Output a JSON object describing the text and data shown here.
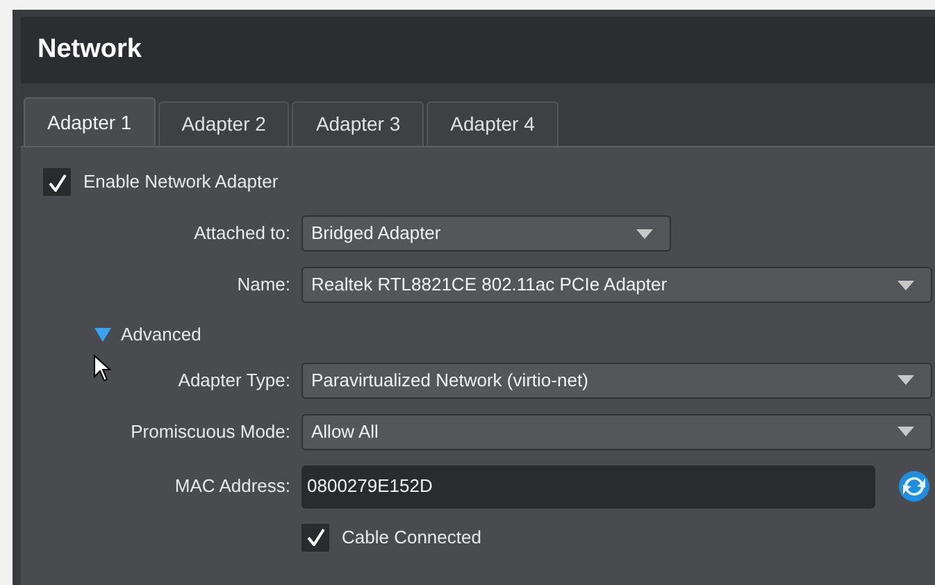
{
  "title": "Network",
  "tabs": [
    {
      "label": "Adapter 1",
      "selected": true
    },
    {
      "label": "Adapter 2",
      "selected": false
    },
    {
      "label": "Adapter 3",
      "selected": false
    },
    {
      "label": "Adapter 4",
      "selected": false
    }
  ],
  "enable": {
    "label": "Enable Network Adapter",
    "checked": true
  },
  "basic_fields": [
    {
      "kind": "narrowcombo",
      "label": "Attached to:",
      "value": "Bridged Adapter"
    },
    {
      "kind": "combo",
      "label": "Name:",
      "value": "Realtek RTL8821CE 802.11ac PCIe Adapter"
    }
  ],
  "advanced": {
    "label": "Advanced",
    "expanded": true
  },
  "advanced_fields": [
    {
      "kind": "combo",
      "label": "Adapter Type:",
      "value": "Paravirtualized Network (virtio-net)"
    },
    {
      "kind": "combo",
      "label": "Promiscuous Mode:",
      "value": "Allow All"
    },
    {
      "kind": "text",
      "label": "MAC Address:",
      "value": "0800279E152D"
    }
  ],
  "cable": {
    "label": "Cable Connected",
    "checked": true
  }
}
